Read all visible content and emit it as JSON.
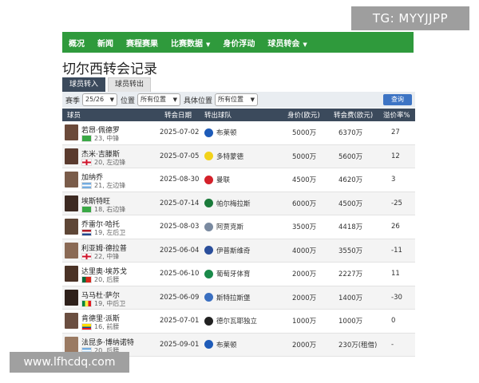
{
  "watermark_top": "TG: MYYJJPP",
  "watermark_bottom": "www.lfhcdq.com",
  "nav": [
    "概况",
    "新闻",
    "赛程赛果",
    "数据",
    "身价浮动",
    "球员转会"
  ],
  "nav_data_label": "比赛数据",
  "page_title": "切尔西转会记录",
  "tabs": {
    "in": "球员转入",
    "out": "球员转出"
  },
  "filter": {
    "season_label": "赛季",
    "season_value": "25/26",
    "position_label": "位置",
    "position_value": "所有位置",
    "detail_label": "具体位置",
    "detail_value": "所有位置",
    "search": "查询"
  },
  "headers": {
    "player": "球员",
    "date": "转会日期",
    "from": "转出球队",
    "value": "身价(欧元)",
    "fee": "转会费(欧元)",
    "premium": "溢价率%"
  },
  "rows": [
    {
      "name": "若昂·佩德罗",
      "num": "23",
      "pos": "中锋",
      "flag": "brazil",
      "date": "2025-07-02",
      "club": "布莱顿",
      "club_color": "#1e5bb8",
      "value": "5000万",
      "fee": "6370万",
      "premium": "27"
    },
    {
      "name": "杰米·吉滕斯",
      "num": "20",
      "pos": "左边锋",
      "flag": "england",
      "date": "2025-07-05",
      "club": "多特蒙德",
      "club_color": "#f2d21a",
      "value": "5000万",
      "fee": "5600万",
      "premium": "12"
    },
    {
      "name": "加纳乔",
      "num": "21",
      "pos": "左边锋",
      "flag": "argentina",
      "date": "2025-08-30",
      "club": "曼联",
      "club_color": "#d4212a",
      "value": "4500万",
      "fee": "4620万",
      "premium": "3"
    },
    {
      "name": "埃斯特旺",
      "num": "18",
      "pos": "右边锋",
      "flag": "brazil",
      "date": "2025-07-14",
      "club": "帕尔梅拉斯",
      "club_color": "#1a7a3a",
      "value": "6000万",
      "fee": "4500万",
      "premium": "-25"
    },
    {
      "name": "乔雷尔·哈托",
      "num": "19",
      "pos": "左后卫",
      "flag": "netherlands",
      "date": "2025-08-03",
      "club": "阿贾克斯",
      "club_color": "#7a8aa0",
      "value": "3500万",
      "fee": "4418万",
      "premium": "26"
    },
    {
      "name": "利亚姆·德拉普",
      "num": "22",
      "pos": "中锋",
      "flag": "england",
      "date": "2025-06-04",
      "club": "伊普斯维奇",
      "club_color": "#2a4e9b",
      "value": "4000万",
      "fee": "3550万",
      "premium": "-11"
    },
    {
      "name": "达里奥·埃苏戈",
      "num": "20",
      "pos": "后腰",
      "flag": "portugal",
      "date": "2025-06-10",
      "club": "葡萄牙体育",
      "club_color": "#1a8a4a",
      "value": "2000万",
      "fee": "2227万",
      "premium": "11"
    },
    {
      "name": "马马杜·萨尔",
      "num": "19",
      "pos": "中后卫",
      "flag": "senegal",
      "date": "2025-06-09",
      "club": "斯特拉斯堡",
      "club_color": "#3a6fc0",
      "value": "2000万",
      "fee": "1400万",
      "premium": "-30"
    },
    {
      "name": "肯德里·派斯",
      "num": "16",
      "pos": "前腰",
      "flag": "ecuador",
      "date": "2025-07-01",
      "club": "德尔瓦耶独立",
      "club_color": "#222222",
      "value": "1000万",
      "fee": "1000万",
      "premium": "0"
    },
    {
      "name": "法昆多·博纳诺特",
      "num": "20",
      "pos": "后腰",
      "flag": "argentina",
      "date": "2025-09-01",
      "club": "布莱顿",
      "club_color": "#1e5bb8",
      "value": "2000万",
      "fee": "230万(租借)",
      "premium": "-"
    }
  ]
}
